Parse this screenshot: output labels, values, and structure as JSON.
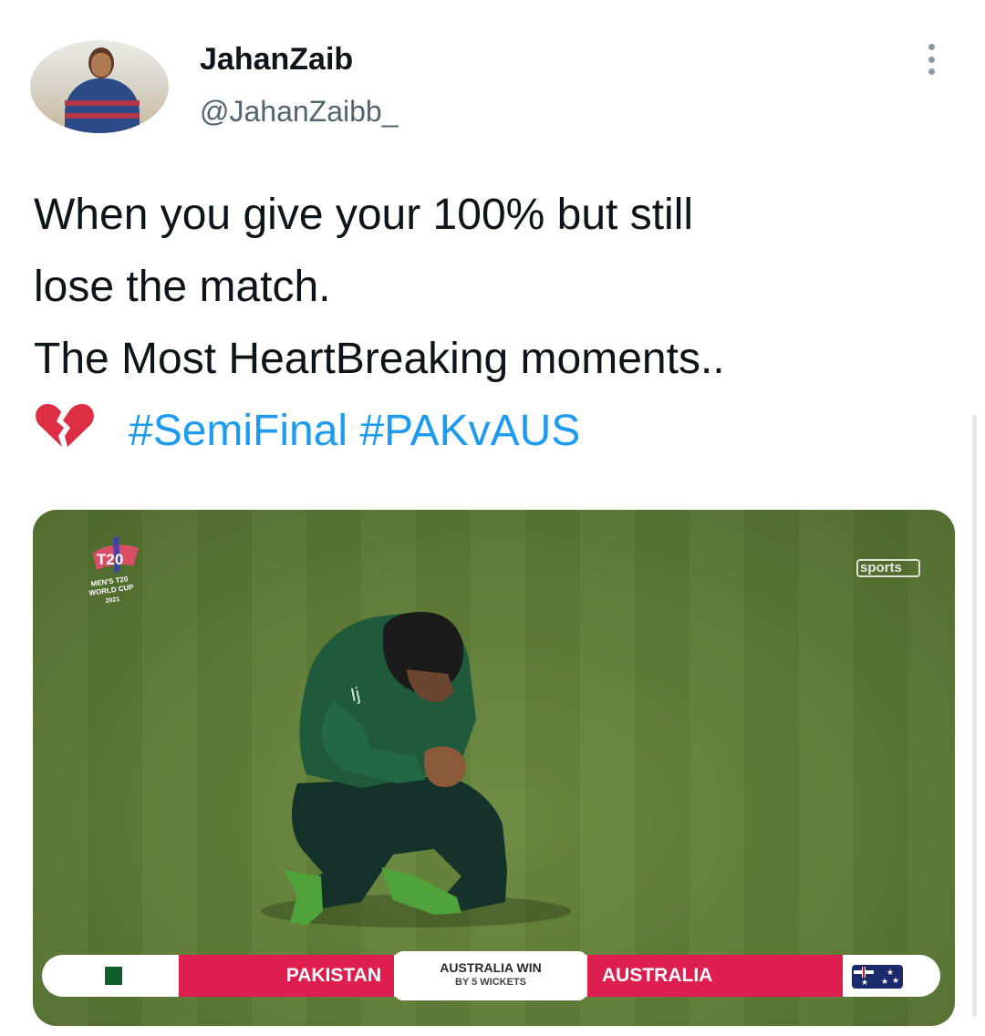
{
  "author": {
    "display_name": "JahanZaib",
    "handle": "@JahanZaibb_"
  },
  "tweet": {
    "lines": [
      "When you give your 100% but still",
      "lose the match.",
      "The Most HeartBreaking moments.."
    ],
    "hashtags": [
      "#SemiFinal",
      "#PAKvAUS"
    ],
    "emoji": "broken-heart"
  },
  "media": {
    "tournament_logo_text": "T20",
    "tournament_subtext": [
      "MEN'S T20",
      "WORLD CUP",
      "2021"
    ],
    "broadcaster_text": "sports",
    "scoreboard": {
      "team_left": "PAKISTAN",
      "team_right": "AUSTRALIA",
      "result": "AUSTRALIA WIN",
      "result_margin": "BY 5 WICKETS",
      "accent_color": "#dd1e4e"
    }
  },
  "icons": {
    "more": "more-options-icon",
    "avatar": "avatar"
  },
  "colors": {
    "hashtag": "#1d9bf0",
    "text": "#0f1419",
    "secondary": "#536471"
  }
}
